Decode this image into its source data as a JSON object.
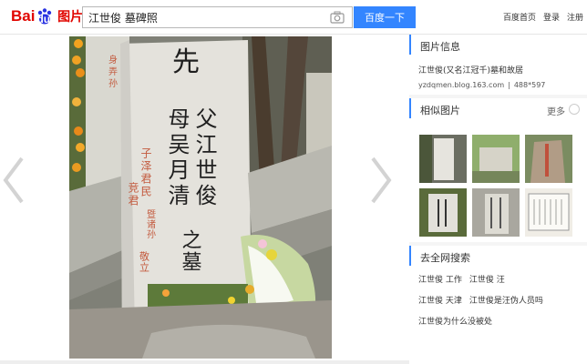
{
  "brand": {
    "logo_text_left": "Bai",
    "logo_text_right": "du",
    "logo_suffix": "图片",
    "accent": "#3385ff",
    "logo_red": "#e10601"
  },
  "search": {
    "query": "江世俊 墓碑照",
    "button_label": "百度一下",
    "camera_icon": "camera-icon"
  },
  "top_links": [
    "百度首页",
    "登录",
    "注册"
  ],
  "viewer": {
    "prev_icon": "chevron-left-icon",
    "next_icon": "chevron-right-icon",
    "stone_title": "先",
    "stone_main_left": "母吴月清",
    "stone_main_right": "父江世俊",
    "stone_end": "之墓",
    "stone_side": "子泽君民",
    "stone_side2": "竞君",
    "stone_side3": "暨诸孙",
    "stone_side4": "敬立",
    "left_stone_text": "身弄孙"
  },
  "sidebar": {
    "info": {
      "title": "图片信息",
      "name": "江世俊(又名江冠千)墓和故居",
      "source": "yzdqmen.blog.163.com",
      "divider": "|",
      "size": "488*597"
    },
    "similar": {
      "title": "相似图片",
      "more_label": "更多"
    },
    "web": {
      "title": "去全网搜索",
      "rows": [
        [
          "江世俊 工作",
          "江世俊 汪"
        ],
        [
          "江世俊 天津",
          "江世俊是汪伪人员吗"
        ],
        [
          "江世俊为什么没被处"
        ]
      ]
    }
  }
}
